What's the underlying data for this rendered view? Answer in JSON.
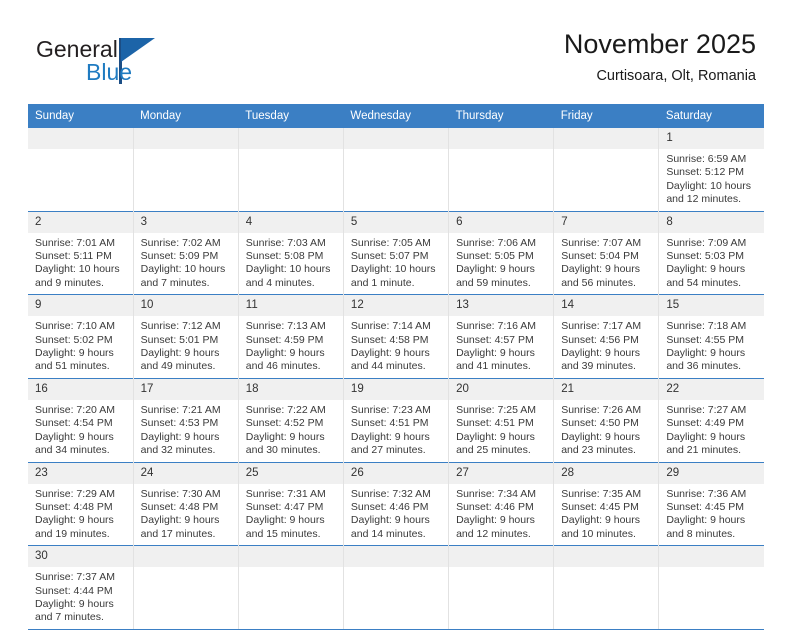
{
  "brand": {
    "name_part1": "General",
    "name_part2": "Blue",
    "logo_icon": "triangle-flag-icon",
    "color_dark": "#231f20",
    "color_blue": "#1f7bc1"
  },
  "header": {
    "title": "November 2025",
    "subtitle": "Curtisoara, Olt, Romania"
  },
  "calendar": {
    "accent_color": "#3b7fc4",
    "daynum_bg": "#f0f0f0",
    "weekday_headers": [
      "Sunday",
      "Monday",
      "Tuesday",
      "Wednesday",
      "Thursday",
      "Friday",
      "Saturday"
    ],
    "weeks": [
      [
        {
          "day": "",
          "lines": []
        },
        {
          "day": "",
          "lines": []
        },
        {
          "day": "",
          "lines": []
        },
        {
          "day": "",
          "lines": []
        },
        {
          "day": "",
          "lines": []
        },
        {
          "day": "",
          "lines": []
        },
        {
          "day": "1",
          "lines": [
            "Sunrise: 6:59 AM",
            "Sunset: 5:12 PM",
            "Daylight: 10 hours",
            "and 12 minutes."
          ]
        }
      ],
      [
        {
          "day": "2",
          "lines": [
            "Sunrise: 7:01 AM",
            "Sunset: 5:11 PM",
            "Daylight: 10 hours",
            "and 9 minutes."
          ]
        },
        {
          "day": "3",
          "lines": [
            "Sunrise: 7:02 AM",
            "Sunset: 5:09 PM",
            "Daylight: 10 hours",
            "and 7 minutes."
          ]
        },
        {
          "day": "4",
          "lines": [
            "Sunrise: 7:03 AM",
            "Sunset: 5:08 PM",
            "Daylight: 10 hours",
            "and 4 minutes."
          ]
        },
        {
          "day": "5",
          "lines": [
            "Sunrise: 7:05 AM",
            "Sunset: 5:07 PM",
            "Daylight: 10 hours",
            "and 1 minute."
          ]
        },
        {
          "day": "6",
          "lines": [
            "Sunrise: 7:06 AM",
            "Sunset: 5:05 PM",
            "Daylight: 9 hours",
            "and 59 minutes."
          ]
        },
        {
          "day": "7",
          "lines": [
            "Sunrise: 7:07 AM",
            "Sunset: 5:04 PM",
            "Daylight: 9 hours",
            "and 56 minutes."
          ]
        },
        {
          "day": "8",
          "lines": [
            "Sunrise: 7:09 AM",
            "Sunset: 5:03 PM",
            "Daylight: 9 hours",
            "and 54 minutes."
          ]
        }
      ],
      [
        {
          "day": "9",
          "lines": [
            "Sunrise: 7:10 AM",
            "Sunset: 5:02 PM",
            "Daylight: 9 hours",
            "and 51 minutes."
          ]
        },
        {
          "day": "10",
          "lines": [
            "Sunrise: 7:12 AM",
            "Sunset: 5:01 PM",
            "Daylight: 9 hours",
            "and 49 minutes."
          ]
        },
        {
          "day": "11",
          "lines": [
            "Sunrise: 7:13 AM",
            "Sunset: 4:59 PM",
            "Daylight: 9 hours",
            "and 46 minutes."
          ]
        },
        {
          "day": "12",
          "lines": [
            "Sunrise: 7:14 AM",
            "Sunset: 4:58 PM",
            "Daylight: 9 hours",
            "and 44 minutes."
          ]
        },
        {
          "day": "13",
          "lines": [
            "Sunrise: 7:16 AM",
            "Sunset: 4:57 PM",
            "Daylight: 9 hours",
            "and 41 minutes."
          ]
        },
        {
          "day": "14",
          "lines": [
            "Sunrise: 7:17 AM",
            "Sunset: 4:56 PM",
            "Daylight: 9 hours",
            "and 39 minutes."
          ]
        },
        {
          "day": "15",
          "lines": [
            "Sunrise: 7:18 AM",
            "Sunset: 4:55 PM",
            "Daylight: 9 hours",
            "and 36 minutes."
          ]
        }
      ],
      [
        {
          "day": "16",
          "lines": [
            "Sunrise: 7:20 AM",
            "Sunset: 4:54 PM",
            "Daylight: 9 hours",
            "and 34 minutes."
          ]
        },
        {
          "day": "17",
          "lines": [
            "Sunrise: 7:21 AM",
            "Sunset: 4:53 PM",
            "Daylight: 9 hours",
            "and 32 minutes."
          ]
        },
        {
          "day": "18",
          "lines": [
            "Sunrise: 7:22 AM",
            "Sunset: 4:52 PM",
            "Daylight: 9 hours",
            "and 30 minutes."
          ]
        },
        {
          "day": "19",
          "lines": [
            "Sunrise: 7:23 AM",
            "Sunset: 4:51 PM",
            "Daylight: 9 hours",
            "and 27 minutes."
          ]
        },
        {
          "day": "20",
          "lines": [
            "Sunrise: 7:25 AM",
            "Sunset: 4:51 PM",
            "Daylight: 9 hours",
            "and 25 minutes."
          ]
        },
        {
          "day": "21",
          "lines": [
            "Sunrise: 7:26 AM",
            "Sunset: 4:50 PM",
            "Daylight: 9 hours",
            "and 23 minutes."
          ]
        },
        {
          "day": "22",
          "lines": [
            "Sunrise: 7:27 AM",
            "Sunset: 4:49 PM",
            "Daylight: 9 hours",
            "and 21 minutes."
          ]
        }
      ],
      [
        {
          "day": "23",
          "lines": [
            "Sunrise: 7:29 AM",
            "Sunset: 4:48 PM",
            "Daylight: 9 hours",
            "and 19 minutes."
          ]
        },
        {
          "day": "24",
          "lines": [
            "Sunrise: 7:30 AM",
            "Sunset: 4:48 PM",
            "Daylight: 9 hours",
            "and 17 minutes."
          ]
        },
        {
          "day": "25",
          "lines": [
            "Sunrise: 7:31 AM",
            "Sunset: 4:47 PM",
            "Daylight: 9 hours",
            "and 15 minutes."
          ]
        },
        {
          "day": "26",
          "lines": [
            "Sunrise: 7:32 AM",
            "Sunset: 4:46 PM",
            "Daylight: 9 hours",
            "and 14 minutes."
          ]
        },
        {
          "day": "27",
          "lines": [
            "Sunrise: 7:34 AM",
            "Sunset: 4:46 PM",
            "Daylight: 9 hours",
            "and 12 minutes."
          ]
        },
        {
          "day": "28",
          "lines": [
            "Sunrise: 7:35 AM",
            "Sunset: 4:45 PM",
            "Daylight: 9 hours",
            "and 10 minutes."
          ]
        },
        {
          "day": "29",
          "lines": [
            "Sunrise: 7:36 AM",
            "Sunset: 4:45 PM",
            "Daylight: 9 hours",
            "and 8 minutes."
          ]
        }
      ],
      [
        {
          "day": "30",
          "lines": [
            "Sunrise: 7:37 AM",
            "Sunset: 4:44 PM",
            "Daylight: 9 hours",
            "and 7 minutes."
          ]
        },
        {
          "day": "",
          "lines": []
        },
        {
          "day": "",
          "lines": []
        },
        {
          "day": "",
          "lines": []
        },
        {
          "day": "",
          "lines": []
        },
        {
          "day": "",
          "lines": []
        },
        {
          "day": "",
          "lines": []
        }
      ]
    ]
  }
}
